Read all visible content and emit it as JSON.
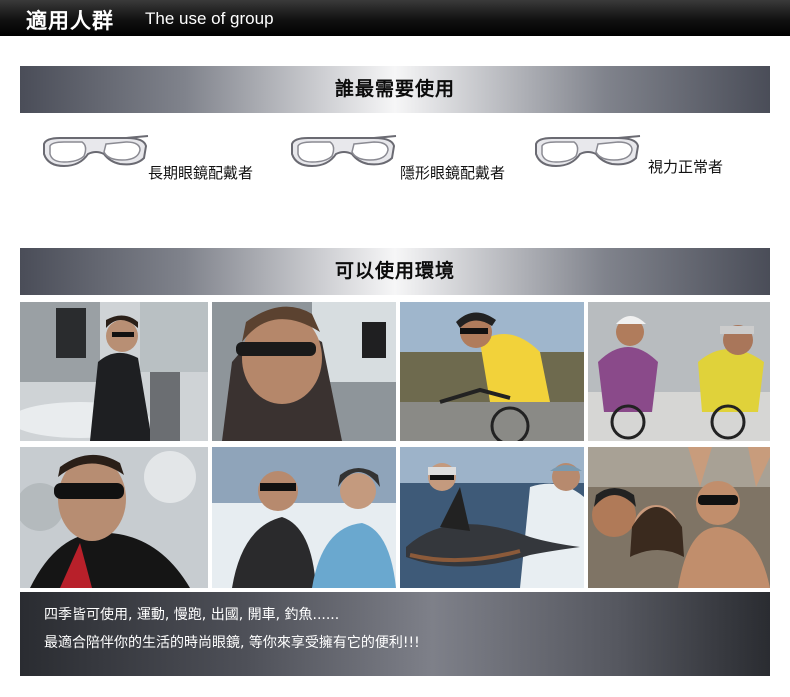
{
  "header": {
    "title_zh": "適用人群",
    "title_en": "The use of group"
  },
  "section1": {
    "title": "誰最需要使用",
    "items": [
      {
        "label": "長期眼鏡配戴者",
        "icon": "glasses-icon"
      },
      {
        "label": "隱形眼鏡配戴者",
        "icon": "glasses-icon"
      },
      {
        "label": "視力正常者",
        "icon": "glasses-icon"
      }
    ]
  },
  "section2": {
    "title": "可以使用環境",
    "photos": [
      {
        "name": "photo-driving-convertible"
      },
      {
        "name": "photo-driving-car"
      },
      {
        "name": "photo-cycling-yellow"
      },
      {
        "name": "photo-cycling-group"
      },
      {
        "name": "photo-skiing-portrait"
      },
      {
        "name": "photo-snow-couple"
      },
      {
        "name": "photo-fishing-marlin"
      },
      {
        "name": "photo-beach-party"
      }
    ]
  },
  "footer": {
    "line1": "四季皆可使用, 運動, 慢跑, 出國, 開車, 釣魚......",
    "line2": "最適合陪伴你的生活的時尚眼鏡, 等你來享受擁有它的便利!!!"
  }
}
